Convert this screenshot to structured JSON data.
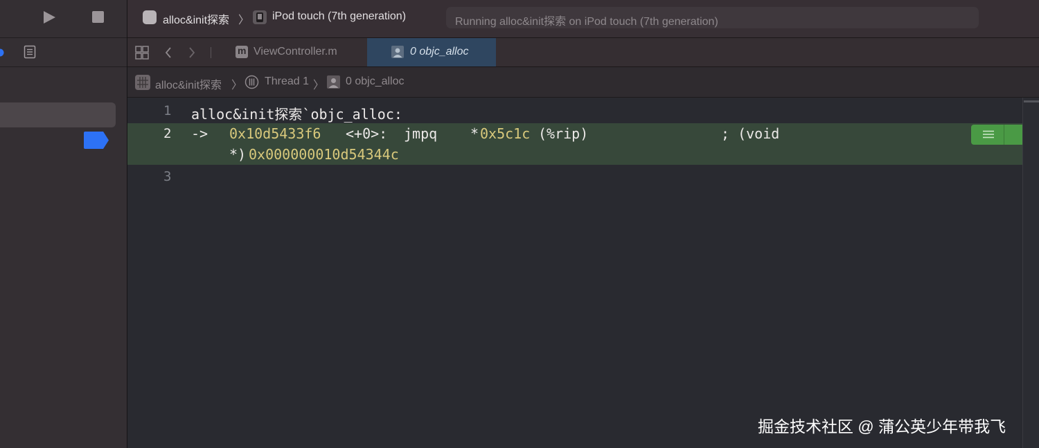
{
  "toolbar": {
    "scheme_name": "alloc&init探索",
    "scheme_separator": "〉",
    "device_name": "iPod touch (7th generation)",
    "status_text": "Running alloc&init探索 on iPod touch (7th generation)"
  },
  "tabs": [
    {
      "label": "ViewController.m",
      "icon_letter": "m",
      "active": false
    },
    {
      "label": "0 objc_alloc",
      "active": true
    }
  ],
  "breadcrumb": [
    {
      "label": "alloc&init探索"
    },
    {
      "label": "Thread 1"
    },
    {
      "label": "0 objc_alloc"
    }
  ],
  "breadcrumb_separator": "〉",
  "code": {
    "lines": [
      {
        "number": "1",
        "text": "alloc&init探索`objc_alloc:"
      },
      {
        "number": "2",
        "arrow": "->",
        "address": "0x10d5433f6",
        "offset": "<+0>:",
        "mnemonic": "jmpq",
        "operand_prefix": "*",
        "operand_value": "0x5c1c",
        "operand_suffix": "(%rip)",
        "comment": "; (void",
        "cont_prefix": "*)",
        "cont_value": "0x000000010d54344c",
        "highlighted": true
      },
      {
        "number": "3",
        "text": ""
      }
    ]
  },
  "watermark": "掘金技术社区 @ 蒲公英少年带我飞",
  "colors": {
    "accent_blue": "#2d72f5",
    "highlight_line": "#37483a",
    "yellow": "#d9c97c",
    "active_tab": "#2f4660",
    "green_badge": "#4a9a45"
  }
}
